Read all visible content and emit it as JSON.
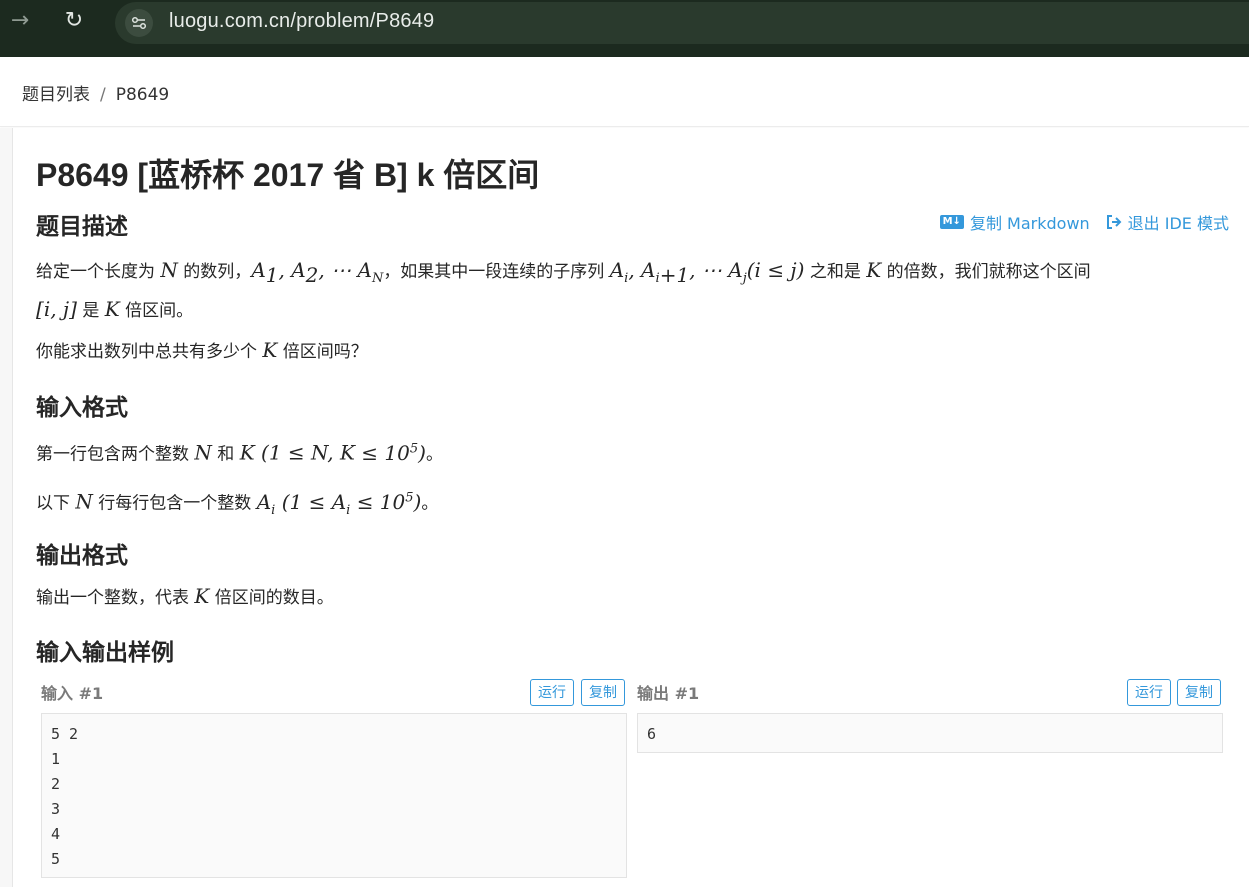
{
  "browser": {
    "url": "luogu.com.cn/problem/P8649"
  },
  "breadcrumb": {
    "list": "题目列表",
    "separator": "/",
    "current": "P8649"
  },
  "problem": {
    "title": "P8649 [蓝桥杯 2017 省 B] k 倍区间",
    "copy_markdown": "复制 Markdown",
    "exit_ide": "退出 IDE 模式",
    "md_badge": "M↓"
  },
  "sections": {
    "description_title": "题目描述",
    "input_title": "输入格式",
    "output_title": "输出格式",
    "samples_title": "输入输出样例"
  },
  "description": {
    "p1_a": "给定一个长度为 ",
    "p1_b": " 的数列，",
    "p1_c": "，如果其中一段连续的子序列 ",
    "p1_d": " 之和是 ",
    "p1_e": " 的倍数，我们就称这个区间",
    "p1_f": " 是 ",
    "p1_g": " 倍区间。",
    "p2_a": "你能求出数列中总共有多少个 ",
    "p2_b": " 倍区间吗？"
  },
  "input_format": {
    "l1_a": "第一行包含两个整数 ",
    "l1_b": " 和 ",
    "l1_c": "。",
    "l2_a": "以下 ",
    "l2_b": " 行每行包含一个整数 ",
    "l2_c": "。"
  },
  "output_format": {
    "l1_a": "输出一个整数，代表 ",
    "l1_b": " 倍区间的数目。"
  },
  "samples": {
    "input_label": "输入 #1",
    "output_label": "输出 #1",
    "run": "运行",
    "copy": "复制",
    "input_text": "5 2\n1\n2\n3\n4\n5",
    "output_text": "6"
  }
}
